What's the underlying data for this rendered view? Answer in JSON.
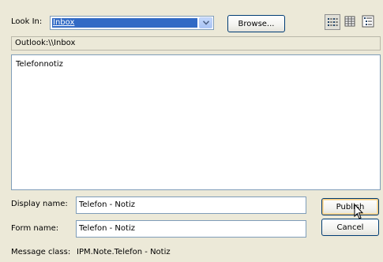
{
  "look_in": {
    "label": "Look In:",
    "value": "Inbox",
    "browse_label": "Browse..."
  },
  "view_buttons": [
    {
      "icon": "list-view-icon",
      "pressed": true
    },
    {
      "icon": "details-view-icon",
      "pressed": false
    },
    {
      "icon": "tree-view-icon",
      "pressed": false
    }
  ],
  "path": "Outlook:\\\\Inbox",
  "forms_list": {
    "items": [
      "Telefonnotiz"
    ]
  },
  "display_name": {
    "label": "Display name:",
    "value": "Telefon - Notiz"
  },
  "form_name": {
    "label": "Form name:",
    "value": "Telefon - Notiz"
  },
  "message_class": {
    "label": "Message class:",
    "value": "IPM.Note.Telefon - Notiz"
  },
  "buttons": {
    "publish_label": "Publish",
    "cancel_label": "Cancel"
  }
}
